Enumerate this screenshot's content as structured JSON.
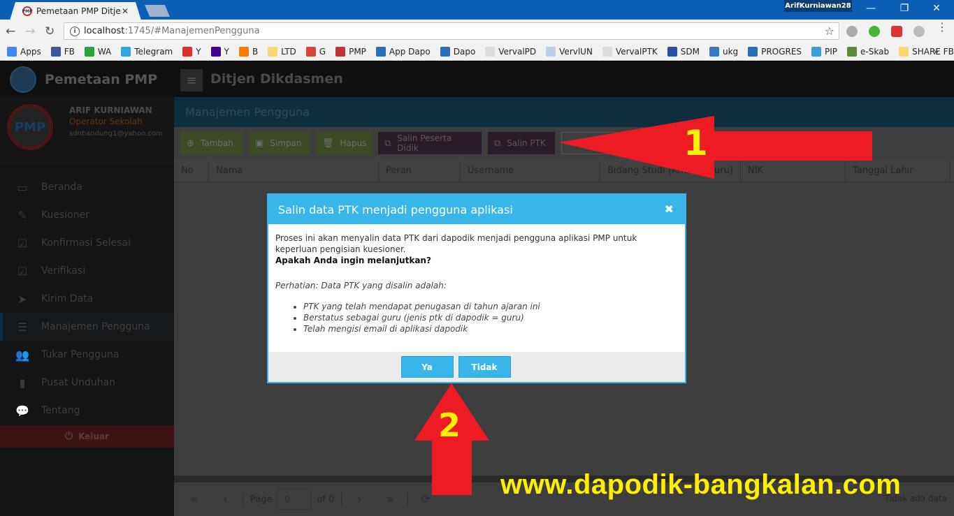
{
  "browser": {
    "tab_title": "Pemetaan PMP Ditjen Dik",
    "profile_name": "ArifKurniawan28",
    "url_host": "localhost",
    "url_path": ":1745/#ManajemenPengguna",
    "bookmarks": [
      {
        "label": "Apps",
        "color": "#4285f4"
      },
      {
        "label": "FB",
        "color": "#3b5998"
      },
      {
        "label": "WA",
        "color": "#2aa33a"
      },
      {
        "label": "Telegram",
        "color": "#2ca5e0"
      },
      {
        "label": "Y",
        "color": "#e52d27"
      },
      {
        "label": "Y",
        "color": "#400191"
      },
      {
        "label": "B",
        "color": "#f57d00"
      },
      {
        "label": "LTD",
        "color": "#f7d774"
      },
      {
        "label": "G",
        "color": "#d44638"
      },
      {
        "label": "PMP",
        "color": "#c33333"
      },
      {
        "label": "App Dapo",
        "color": "#2a6fb5"
      },
      {
        "label": "Dapo",
        "color": "#2a6fb5"
      },
      {
        "label": "VervalPD",
        "color": "#dddddd"
      },
      {
        "label": "VervlUN",
        "color": "#b8cfe6"
      },
      {
        "label": "VervalPTK",
        "color": "#dddddd"
      },
      {
        "label": "SDM",
        "color": "#2a4fa5"
      },
      {
        "label": "ukg",
        "color": "#3a78c0"
      },
      {
        "label": "PROGRES",
        "color": "#2a6fb5"
      },
      {
        "label": "PIP",
        "color": "#3a9fd5"
      },
      {
        "label": "e-Skab",
        "color": "#5a8a3a"
      },
      {
        "label": "SHARE FB",
        "color": "#f7d774"
      }
    ],
    "bookmarks_overflow": "»"
  },
  "app": {
    "brand": "Pemetaan PMP",
    "org": "Ditjen Dikdasmen",
    "user": {
      "name": "ARIF KURNIAWAN",
      "role": "Operator Sekolah",
      "email": "sdnbandung1@yahoo.com",
      "avatar_text": "PMP"
    },
    "menu": [
      {
        "label": "Beranda",
        "icon": "monitor-icon",
        "glyph": "▭"
      },
      {
        "label": "Kuesioner",
        "icon": "edit-icon",
        "glyph": "✎"
      },
      {
        "label": "Konfirmasi Selesai",
        "icon": "checkbox-outline-icon",
        "glyph": "☑"
      },
      {
        "label": "Verifikasi",
        "icon": "checkbox-icon",
        "glyph": "☑"
      },
      {
        "label": "Kirim Data",
        "icon": "send-icon",
        "glyph": "➤"
      },
      {
        "label": "Manajemen Pengguna",
        "icon": "list-icon",
        "glyph": "☰",
        "active": true
      },
      {
        "label": "Tukar Pengguna",
        "icon": "users-icon",
        "glyph": "👥"
      },
      {
        "label": "Pusat Unduhan",
        "icon": "file-icon",
        "glyph": "▮"
      },
      {
        "label": "Tentang",
        "icon": "comments-icon",
        "glyph": "💬"
      }
    ],
    "logout": "Keluar",
    "page_title": "Manajemen Pengguna",
    "actions": {
      "add": "Tambah",
      "save": "Simpan",
      "delete": "Hapus",
      "copy_students": "Salin Peserta Didik",
      "copy_ptk": "Salin PTK"
    },
    "columns": [
      "No",
      "Nama",
      "Peran",
      "Username",
      "Bidang Studi (Khusus Guru)",
      "NIK",
      "Tanggal Lahir"
    ],
    "pager": {
      "page_label": "Page",
      "page_value": "0",
      "of_label": "of 0",
      "info": "Tidak ada data"
    }
  },
  "modal": {
    "title": "Salin data PTK menjadi pengguna aplikasi",
    "intro": "Proses ini akan menyalin data PTK dari dapodik menjadi pengguna aplikasi PMP untuk keperluan pengisian kuesioner.",
    "question": "Apakah Anda ingin melanjutkan?",
    "note": "Perhatian: Data PTK yang disalin adalah:",
    "criteria": [
      "PTK yang telah mendapat penugasan di tahun ajaran ini",
      "Berstatus sebagai guru (jenis ptk di dapodik = guru)",
      "Telah mengisi email di aplikasi dapodik"
    ],
    "yes": "Ya",
    "no": "Tidak"
  },
  "annotations": {
    "step1": "1",
    "step2": "2",
    "watermark": "www.dapodik-bangkalan.com",
    "arrow_color": "#ed1c24",
    "number_color": "#ffef00"
  }
}
